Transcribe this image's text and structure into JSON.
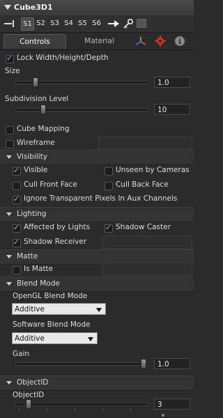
{
  "title": "Cube3D1",
  "toolbar": {
    "items": [
      "S1",
      "S2",
      "S3",
      "S4",
      "S5",
      "S6"
    ]
  },
  "tabs": {
    "controls": "Controls",
    "material": "Material"
  },
  "lock_label": "Lock Width/Height/Depth",
  "size": {
    "label": "Size",
    "value": "1.0"
  },
  "subdivision": {
    "label": "Subdivision Level",
    "value": "10"
  },
  "cube_mapping": "Cube Mapping",
  "wireframe": "Wireframe",
  "visibility": {
    "header": "Visibility",
    "visible": "Visible",
    "unseen": "Unseen by Cameras",
    "cull_front": "Cull Front Face",
    "cull_back": "Cull Back Face",
    "ignore_transparent": "Ignore Transparent Pixels In Aux Channels"
  },
  "lighting": {
    "header": "Lighting",
    "affected": "Affected by Lights",
    "shadow_caster": "Shadow Caster",
    "shadow_receiver": "Shadow Receiver"
  },
  "matte": {
    "header": "Matte",
    "is_matte": "Is Matte"
  },
  "blend": {
    "header": "Blend Mode",
    "opengl_label": "OpenGL Blend Mode",
    "opengl_value": "Additive",
    "software_label": "Software Blend Mode",
    "software_value": "Additive",
    "gain_label": "Gain",
    "gain_value": "1.0"
  },
  "object_id": {
    "header": "ObjectID",
    "label": "ObjectID",
    "value": "3"
  },
  "colors": {
    "background": "#2b2b2b",
    "check_accent": "#7fb5ff",
    "gear_icon": "#c0392b"
  }
}
